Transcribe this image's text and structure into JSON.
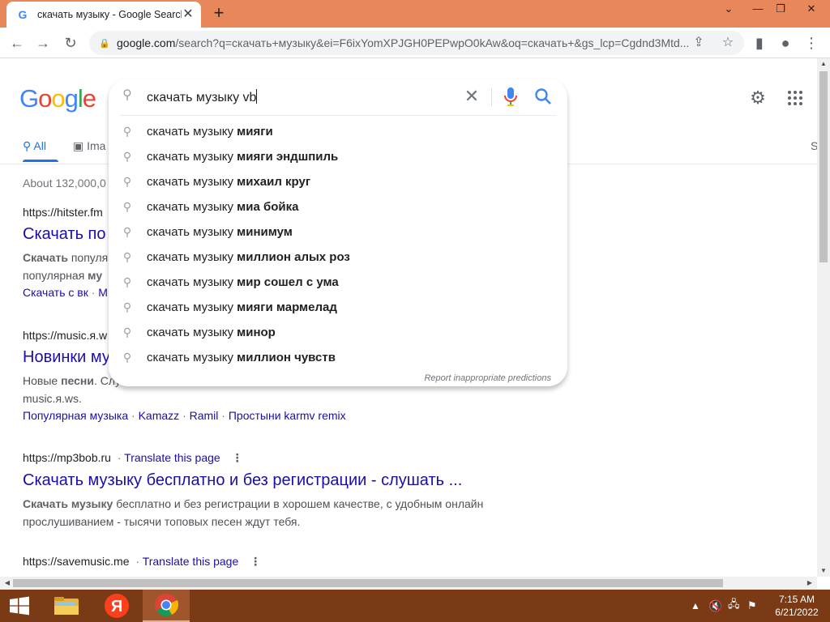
{
  "browser": {
    "tab_title": "скачать музыку - Google Search",
    "tab_favicon": "google-favicon",
    "new_tab": "+",
    "window_controls": {
      "collapse": "⌄",
      "minimize": "—",
      "restore": "❐",
      "close": "✕"
    },
    "url_host": "google.com",
    "url_rest": "/search?q=скачать+музыку&ei=F6ixYomXPJGH0PEPwpO0kAw&oq=скачать+&gs_lcp=Cgdnd3Mtd..."
  },
  "logo": [
    "G",
    "o",
    "o",
    "g",
    "l",
    "e"
  ],
  "search": {
    "query": "скачать музыку vb",
    "suggestions": [
      {
        "prefix": "скачать музыку ",
        "bold": "мияги"
      },
      {
        "prefix": "скачать музыку ",
        "bold": "мияги эндшпиль"
      },
      {
        "prefix": "скачать музыку ",
        "bold": "михаил круг"
      },
      {
        "prefix": "скачать музыку ",
        "bold": "миа бойка"
      },
      {
        "prefix": "скачать музыку ",
        "bold": "минимум"
      },
      {
        "prefix": "скачать музыку ",
        "bold": "миллион алых роз"
      },
      {
        "prefix": "скачать музыку ",
        "bold": "мир сошел с ума"
      },
      {
        "prefix": "скачать музыку ",
        "bold": "мияги мармелад"
      },
      {
        "prefix": "скачать музыку ",
        "bold": "минор"
      },
      {
        "prefix": "скачать музыку ",
        "bold": "миллион чувств"
      }
    ],
    "report_text": "Report inappropriate predictions"
  },
  "nav": {
    "all": "All",
    "images": "Ima",
    "right_fragment": "S"
  },
  "stats": "About 132,000,0",
  "results": [
    {
      "cite": "https://hitster.fm",
      "title": "Скачать по",
      "snippet_bold1": "Скачать",
      "snippet_text1": " популя",
      "snippet_text2": "популярная ",
      "snippet_bold2": "му",
      "links": [
        "Скачать с вк",
        "М"
      ]
    },
    {
      "cite": "https://music.я.w",
      "title": "Новинки му",
      "snippet_text1": "Новые ",
      "snippet_bold1": "песни",
      "snippet_text2": ". Слу",
      "snippet_line2": "music.я.ws.",
      "links": [
        "Популярная музыка",
        "Kamazz",
        "Ramil",
        "Простыни karmv remix"
      ]
    },
    {
      "cite": "https://mp3bob.ru",
      "translate": "Translate this page",
      "title": "Скачать музыку бесплатно и без регистрации - слушать ...",
      "snippet_bold1": "Скачать музыку",
      "snippet_text1": " бесплатно и без регистрации в хорошем качестве, с удобным онлайн",
      "snippet_line2": "прослушиванием - тысячи топовых песен ждут тебя."
    },
    {
      "cite": "https://savemusic.me",
      "translate": "Translate this page"
    }
  ],
  "taskbar": {
    "time": "7:15 AM",
    "date": "6/21/2022"
  }
}
